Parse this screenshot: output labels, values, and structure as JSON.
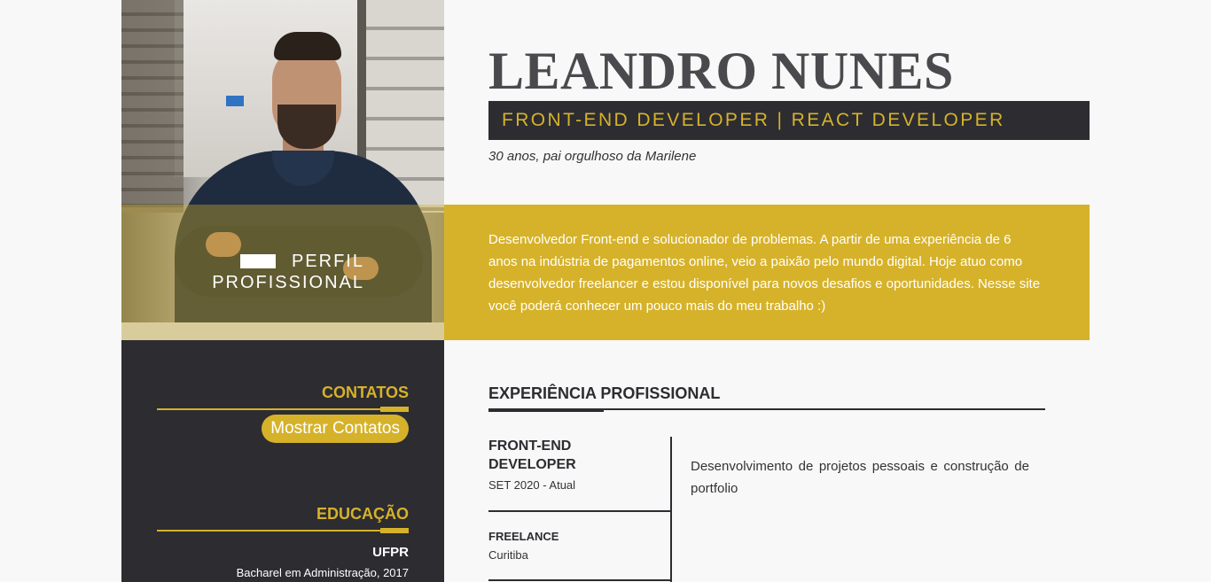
{
  "header": {
    "name": "LEANDRO NUNES",
    "role": "FRONT-END DEVELOPER | REACT DEVELOPER",
    "tagline": "30 anos, pai orgulhoso da Marilene"
  },
  "profile": {
    "label_line1": "PERFIL",
    "label_line2": "PROFISSIONAL",
    "about": "Desenvolvedor Front-end e solucionador de problemas. A partir de uma experiência de 6 anos na indústria de pagamentos online, veio a paixão pelo mundo digital. Hoje atuo como desenvolvedor freelancer e estou disponível para novos desafios e oportunidades. Nesse site você poderá conhecer um pouco mais do meu trabalho :)"
  },
  "sidebar": {
    "contacts_title": "CONTATOS",
    "contacts_button": "Mostrar Contatos",
    "education_title": "EDUCAÇÃO",
    "education": {
      "school": "UFPR",
      "degree": "Bacharel em Administração, 2017"
    }
  },
  "experience": {
    "title": "EXPERIÊNCIA PROFISSIONAL",
    "jobs": [
      {
        "title": "FRONT-END DEVELOPER",
        "date": "SET 2020 - Atual",
        "description": "Desenvolvimento de projetos pessoais e construção de portfolio"
      },
      {
        "title": "FREELANCE",
        "place": "Curitiba"
      }
    ]
  },
  "colors": {
    "accent": "#d6b22a",
    "dark": "#2c2c31",
    "background": "#f8f8f8"
  }
}
